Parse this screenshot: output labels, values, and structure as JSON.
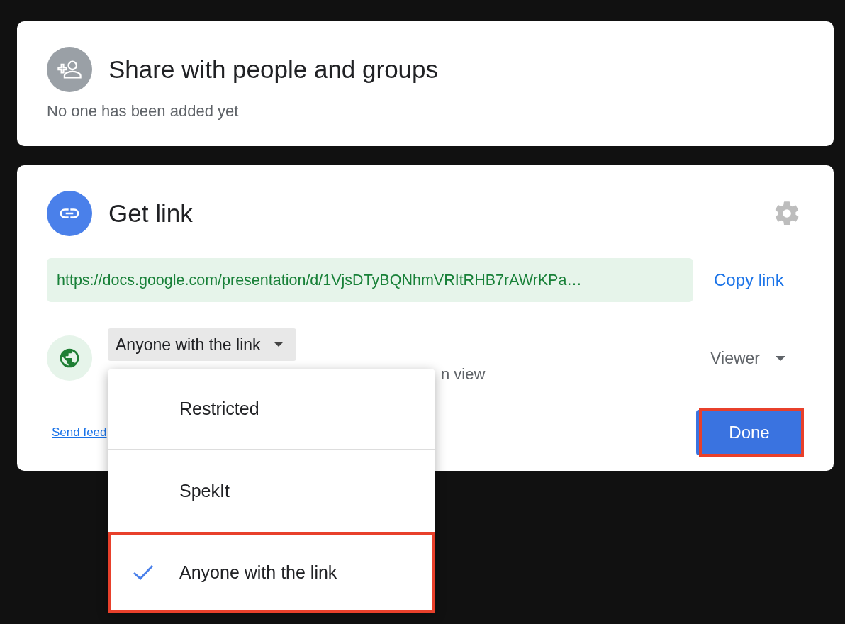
{
  "share_card": {
    "title": "Share with people and groups",
    "subtitle": "No one has been added yet"
  },
  "link_card": {
    "title": "Get link",
    "url": "https://docs.google.com/presentation/d/1VjsDTyBQNhmVRItRHB7rAWrKPa…",
    "copy_label": "Copy link",
    "access_dropdown": {
      "label": "Anyone with the link",
      "expanded": true
    },
    "description": "n view",
    "role": "Viewer",
    "feedback_link": "Send feed",
    "done_button": {
      "label": "Done",
      "highlighted": true
    }
  },
  "access_menu": [
    {
      "label": "Restricted",
      "selected": false,
      "highlighted": false
    },
    {
      "label": "SpekIt",
      "selected": false,
      "highlighted": false
    },
    {
      "label": "Anyone with the link",
      "selected": true,
      "highlighted": true
    }
  ]
}
